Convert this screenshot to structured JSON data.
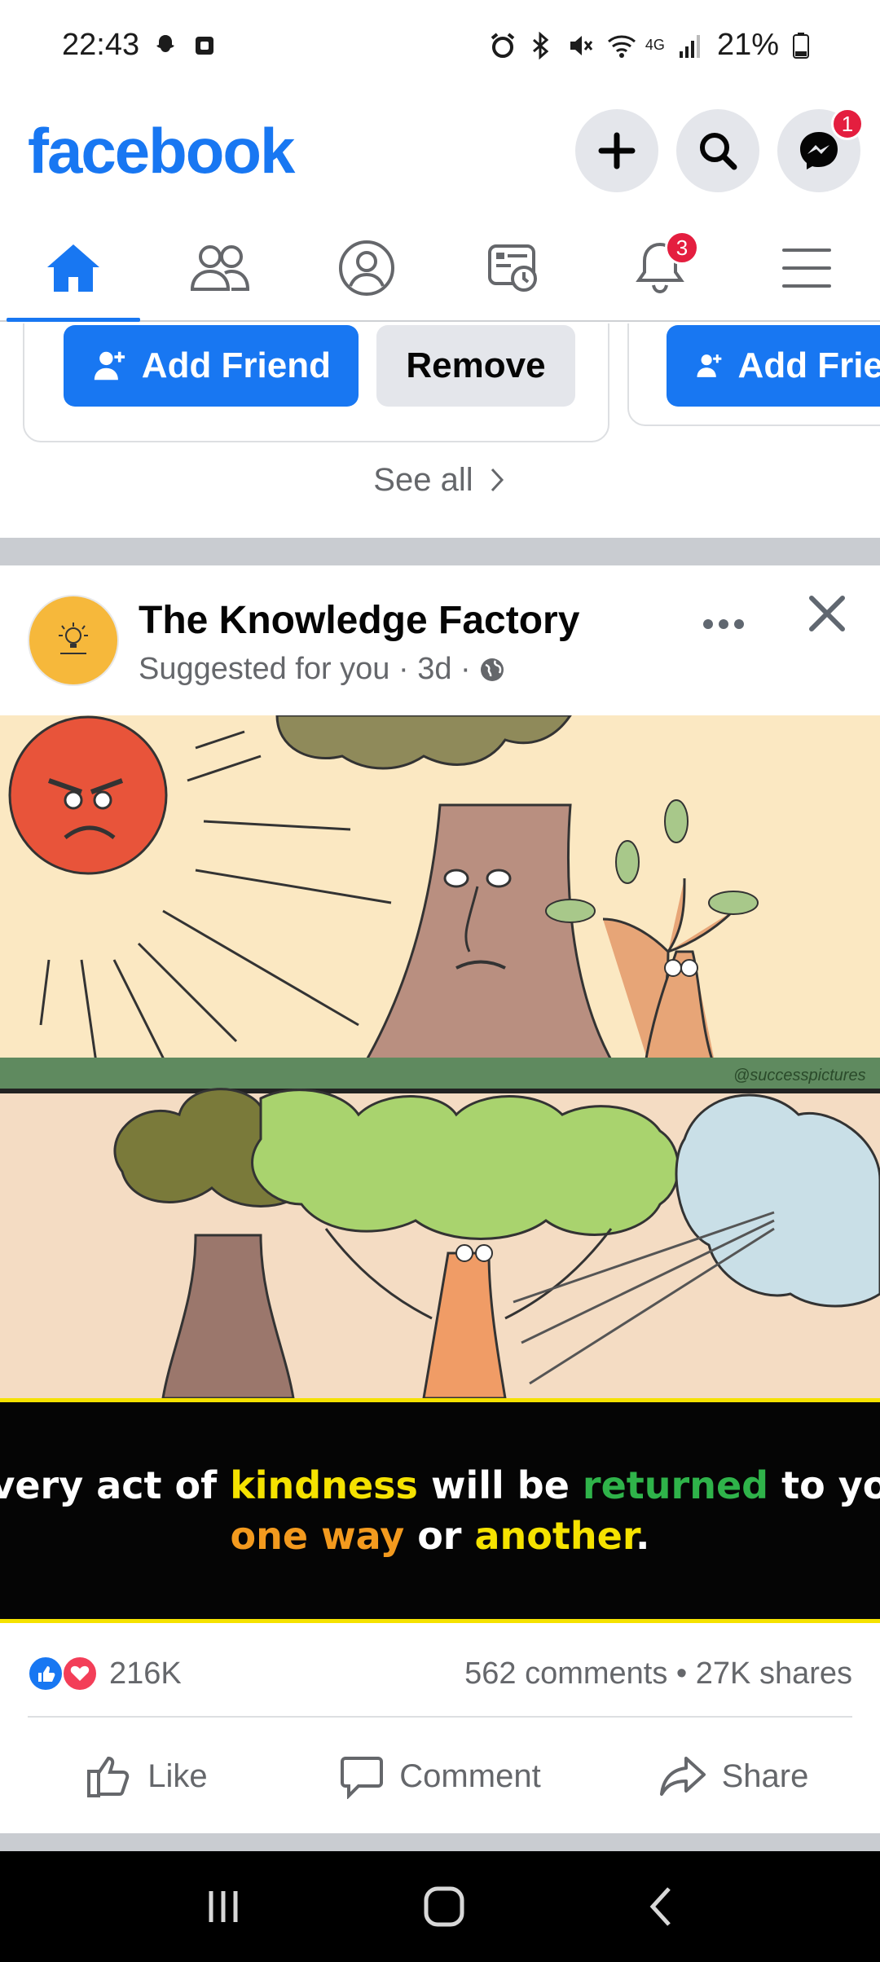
{
  "status_bar": {
    "time": "22:43",
    "network": "4G",
    "battery": "21%"
  },
  "header": {
    "logo": "facebook",
    "messenger_badge": "1"
  },
  "nav": {
    "notifications_badge": "3"
  },
  "suggestions": {
    "add_friend_label": "Add Friend",
    "add_friend_label_partial": "Add Frie",
    "remove_label": "Remove",
    "see_all_label": "See all"
  },
  "post": {
    "page_name": "The Knowledge Factory",
    "meta_text": "Suggested for you · 3d ·",
    "watermark": "@successpictures",
    "caption_line1": [
      {
        "text": "Every act of ",
        "color": "#ffffff"
      },
      {
        "text": "kindness",
        "color": "#f5e200"
      },
      {
        "text": " will be ",
        "color": "#ffffff"
      },
      {
        "text": "returned",
        "color": "#2fb34a"
      },
      {
        "text": " to you",
        "color": "#ffffff"
      }
    ],
    "caption_line2": [
      {
        "text": "one way",
        "color": "#f39a1e"
      },
      {
        "text": " or ",
        "color": "#ffffff"
      },
      {
        "text": "another",
        "color": "#f5e200"
      },
      {
        "text": ".",
        "color": "#ffffff"
      }
    ],
    "reactions_count": "216K",
    "comments_shares": "562 comments • 27K shares",
    "like_label": "Like",
    "comment_label": "Comment",
    "share_label": "Share"
  },
  "colors": {
    "brand": "#1877f2",
    "badge": "#e41e3f"
  }
}
